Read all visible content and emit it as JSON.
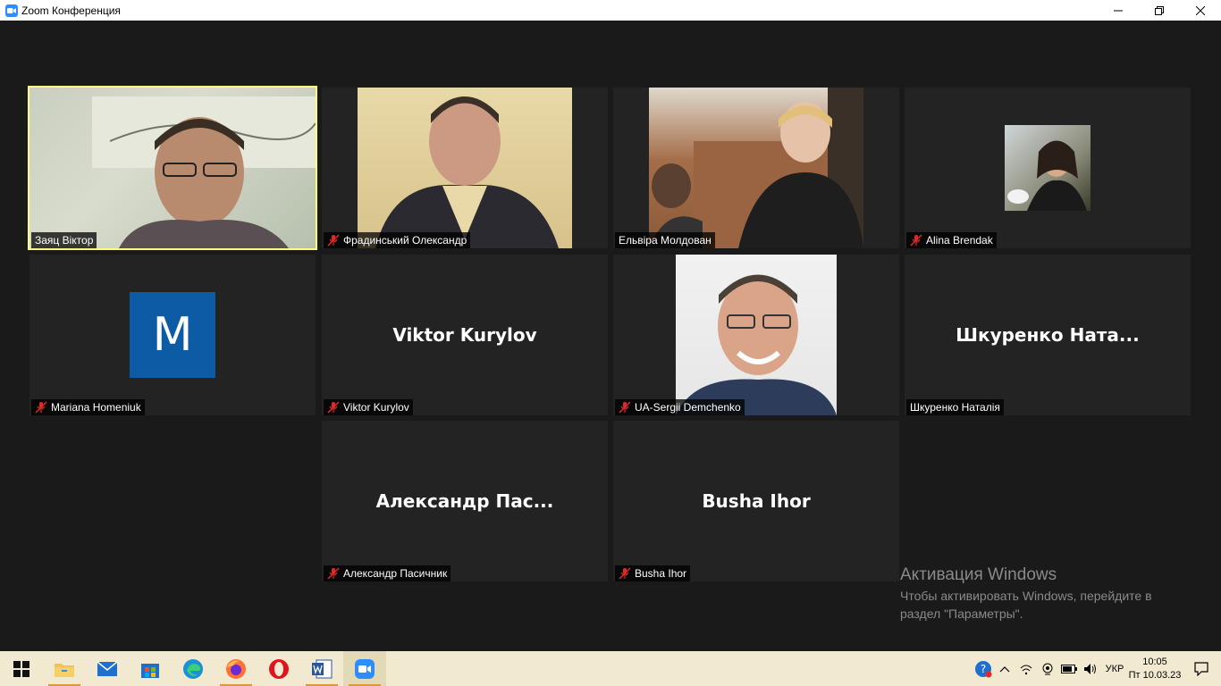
{
  "window": {
    "title": "Zoom Конференция"
  },
  "participants": [
    {
      "name": "Заяц Віктор",
      "muted": false,
      "active": true
    },
    {
      "name": "Фрадинський Олександр",
      "muted": true
    },
    {
      "name": "Ельвіра Молдован",
      "muted": false
    },
    {
      "name": "Alina Brendak",
      "muted": true
    },
    {
      "name": "Mariana Homeniuk",
      "muted": true,
      "avatar_letter": "M"
    },
    {
      "name": "Viktor Kurylov",
      "muted": true,
      "display_name": "Viktor Kurylov"
    },
    {
      "name": "UA-Sergii Demchenko",
      "muted": true
    },
    {
      "name": "Шкуренко Наталія",
      "muted": false,
      "display_name": "Шкуренко  Ната..."
    },
    {
      "name": "Александр Пасичник",
      "muted": true,
      "display_name": "Александр  Пас..."
    },
    {
      "name": "Busha Ihor",
      "muted": true,
      "display_name": "Busha Ihor"
    }
  ],
  "activation": {
    "title": "Активация Windows",
    "line1": "Чтобы активировать Windows, перейдите в",
    "line2": "раздел \"Параметры\"."
  },
  "taskbar": {
    "language": "УКР",
    "time": "10:05",
    "date": "Пт 10.03.23"
  },
  "colors": {
    "active_speaker": "#ffff7f",
    "stage_bg": "#1a1a1a",
    "tile_bg": "#232323",
    "mute_red": "#e02828"
  }
}
